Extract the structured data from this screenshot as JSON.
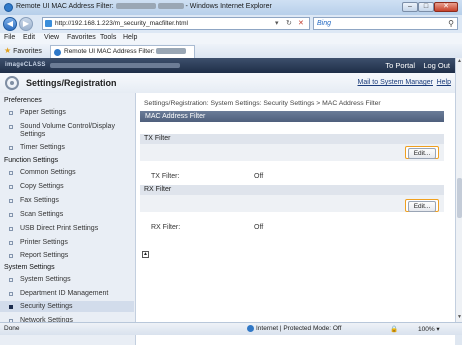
{
  "window": {
    "title_prefix": "Remote UI MAC Address Filter:",
    "title_suffix": "- Windows Internet Explorer",
    "min_label": "–",
    "max_label": "□",
    "close_label": "✕"
  },
  "address_bar": {
    "url": "http://192.168.1.223/m_security_macfilter.html",
    "refresh_label": "↻",
    "stop_label": "✕",
    "search_engine": "Bing",
    "back_label": "◀",
    "forward_label": "▶",
    "dropdown_label": "▾",
    "search_icon": "⚲"
  },
  "menu": {
    "items": [
      "File",
      "Edit",
      "View",
      "Favorites",
      "Tools",
      "Help"
    ]
  },
  "favorites_bar": {
    "favorites_label": "Favorites",
    "tab_title": "Remote UI MAC Address Filter:"
  },
  "header": {
    "logo": "imageCLASS",
    "to_portal": "To Portal",
    "log_out": "Log Out"
  },
  "settings_bar": {
    "title": "Settings/Registration",
    "mail_link": "Mail to System Manager",
    "help_link": "Help"
  },
  "sidebar": {
    "preferences": "Preferences",
    "pref_items": [
      "Paper Settings",
      "Sound Volume Control/Display Settings",
      "Timer Settings"
    ],
    "function_settings": "Function Settings",
    "func_items": [
      "Common Settings",
      "Copy Settings",
      "Fax Settings",
      "Scan Settings",
      "USB Direct Print Settings",
      "Printer Settings",
      "Report Settings"
    ],
    "system_settings": "System Settings",
    "sys_items": [
      "System Settings",
      "Department ID Management",
      "Security Settings",
      "Network Settings"
    ]
  },
  "main": {
    "breadcrumb": "Settings/Registration: System Settings: Security Settings > MAC Address Filter",
    "page_header": "MAC Address Filter",
    "tx_section": "TX Filter",
    "tx_edit": "Edit...",
    "tx_filter_label": "TX Filter:",
    "tx_filter_value": "Off",
    "rx_section": "RX Filter",
    "rx_edit": "Edit...",
    "rx_filter_label": "RX Filter:",
    "rx_filter_value": "Off",
    "to_top_icon": "▲"
  },
  "status_bar": {
    "status": "Done",
    "zone": "Internet | Protected Mode: Off",
    "zoom": "100%",
    "security_icon": "🔒"
  }
}
